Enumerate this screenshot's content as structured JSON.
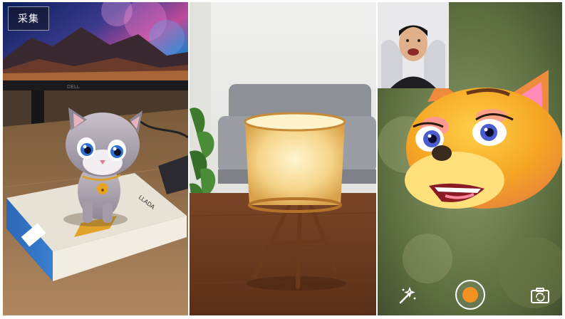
{
  "overlay": {
    "capture_label": "采集"
  },
  "icons": {
    "effects": "magic-wand-icon",
    "shutter": "record-icon",
    "flip_camera": "camera-flip-icon"
  },
  "colors": {
    "shutter_accent": "#f39221"
  }
}
